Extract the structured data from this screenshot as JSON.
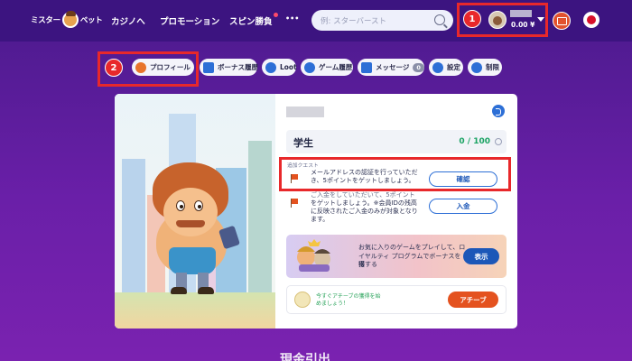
{
  "header": {
    "logo_left": "ミスター",
    "logo_right": "ベット",
    "nav": [
      "カジノへ",
      "プロモーション",
      "スピン勝負"
    ],
    "more_label": "•••",
    "search_placeholder": "例: スターバースト",
    "account": {
      "balance": "0.00 ¥"
    },
    "callout_1": "1"
  },
  "tabs": {
    "callout_2": "2",
    "items": [
      {
        "label": "プロフィール",
        "icon": "user-icon"
      },
      {
        "label": "ボーナス履歴",
        "icon": "gift-icon"
      },
      {
        "label": "Loot",
        "icon": "potion-icon"
      },
      {
        "label": "ゲーム履歴",
        "icon": "clock-icon"
      },
      {
        "label": "メッセージ",
        "icon": "mail-icon",
        "count": "0"
      },
      {
        "label": "設定",
        "icon": "gear-icon"
      },
      {
        "label": "制限",
        "icon": "lock-icon"
      }
    ]
  },
  "profile": {
    "level_name": "学生",
    "level_score": "0 / 100",
    "quest_label": "追加クエスト",
    "quests": [
      {
        "text_1": "メールアドレスの認証を行っていただ",
        "text_2": "き、5ポイントをゲットしましょう。",
        "button": "確認"
      },
      {
        "text_1": "ご入金をしていただいて、5ポイント",
        "text_2": "をゲットしましょう。※会員IDの残高",
        "text_3": "に反映されたご入金のみが対象となり",
        "text_4": "ます。",
        "button": "入金"
      }
    ],
    "loyalty": {
      "text_1": "お気に入りのゲームをプレイして、ロ",
      "text_2": "イヤルティ プログラムでボーナスを獲",
      "text_3": "得する",
      "button": "表示"
    },
    "achieve": {
      "text_1": "今すぐアチーブの獲得を始",
      "text_2": "めましょう！",
      "button": "アチーブ"
    }
  },
  "footer_partial": "現金引出",
  "colors": {
    "background": "#5a1d9c",
    "header": "#3c1480",
    "highlight": "#e8282b",
    "primary_blue": "#1c57b8",
    "accent_orange": "#e4521f",
    "score_green": "#1aa363"
  }
}
